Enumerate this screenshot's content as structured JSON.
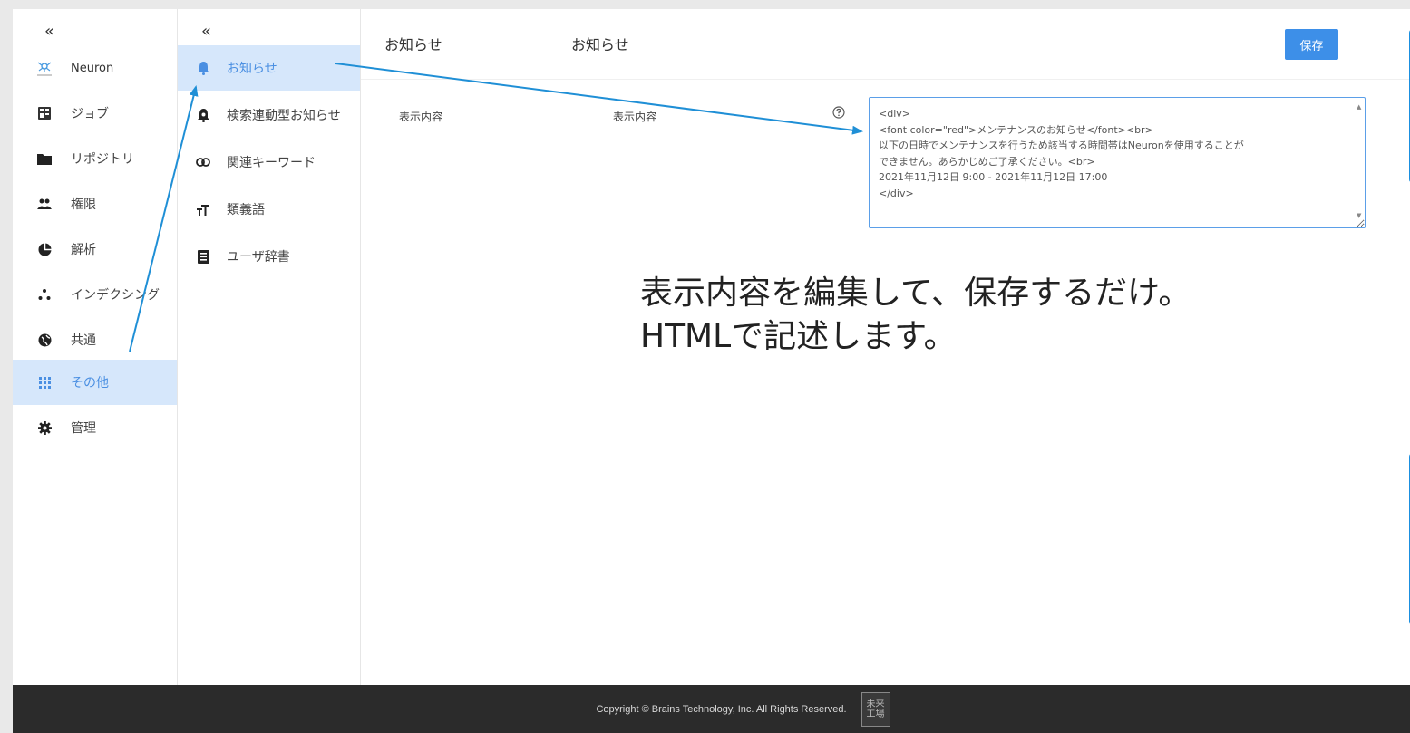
{
  "nav1": {
    "collapse": "«",
    "items": [
      {
        "label": "Neuron",
        "icon": "neuron-logo-icon"
      },
      {
        "label": "ジョブ",
        "icon": "job-icon"
      },
      {
        "label": "リポジトリ",
        "icon": "folder-icon"
      },
      {
        "label": "権限",
        "icon": "users-icon"
      },
      {
        "label": "解析",
        "icon": "pie-chart-icon"
      },
      {
        "label": "インデクシング",
        "icon": "dots-icon"
      },
      {
        "label": "共通",
        "icon": "globe-icon"
      },
      {
        "label": "その他",
        "icon": "grid-icon",
        "active": true
      },
      {
        "label": "管理",
        "icon": "gear-icon"
      }
    ]
  },
  "nav2": {
    "collapse": "«",
    "items": [
      {
        "label": "お知らせ",
        "icon": "bell-icon",
        "active": true
      },
      {
        "label": "検索連動型お知らせ",
        "icon": "bell-search-icon"
      },
      {
        "label": "関連キーワード",
        "icon": "link-icon"
      },
      {
        "label": "類義語",
        "icon": "text-size-icon"
      },
      {
        "label": "ユーザ辞書",
        "icon": "book-icon"
      }
    ]
  },
  "main": {
    "title": "お知らせ",
    "title2": "お知らせ",
    "save_label": "保存",
    "field_label": "表示内容",
    "field_label2": "表示内容",
    "content": "<div>\n<font color=\"red\">メンテナンスのお知らせ</font><br>\n以下の日時でメンテナンスを行うため該当する時間帯はNeuronを使用することが\nできません。あらかじめご了承ください。<br>\n2021年11月12日 9:00 - 2021年11月12日 17:00\n</div>"
  },
  "annotation": {
    "line1": "表示内容を編集して、保存するだけ。",
    "line2": "HTMLで記述します。"
  },
  "footer": {
    "copyright": "Copyright © Brains Technology, Inc. All Rights Reserved.",
    "logo_text": "未来\n工場"
  },
  "colors": {
    "accent": "#3d8fe8",
    "active_bg": "#d6e7fb",
    "arrow": "#1f8fd6",
    "footer_bg": "#2b2b2b"
  }
}
